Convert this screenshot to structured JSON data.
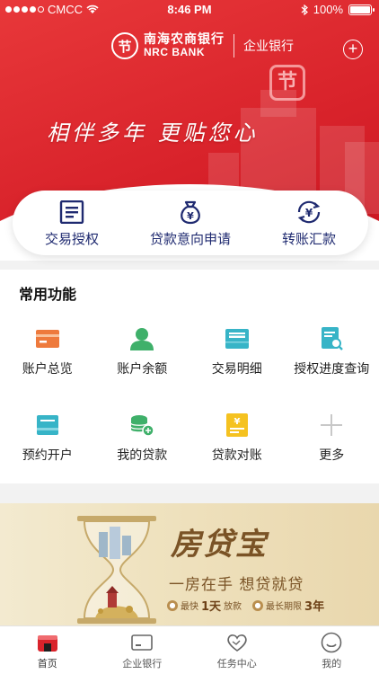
{
  "status_bar": {
    "carrier": "CMCC",
    "time": "8:46 PM",
    "battery": "100%"
  },
  "header": {
    "bank_name_cn": "南海农商银行",
    "bank_name_en": "NRC BANK",
    "corporate": "企业银行",
    "logo_glyph": "节",
    "slogan": "相伴多年 更贴您心",
    "add_icon": "plus-circle-icon"
  },
  "quick_actions": [
    {
      "label": "交易授权",
      "icon": "document-list-icon"
    },
    {
      "label": "贷款意向申请",
      "icon": "money-bag-icon"
    },
    {
      "label": "转账汇款",
      "icon": "transfer-cycle-icon"
    }
  ],
  "common_functions": {
    "title": "常用功能",
    "items": [
      {
        "label": "账户总览",
        "icon": "card-icon"
      },
      {
        "label": "账户余额",
        "icon": "user-icon"
      },
      {
        "label": "交易明细",
        "icon": "receipt-icon"
      },
      {
        "label": "授权进度查询",
        "icon": "document-search-icon"
      },
      {
        "label": "预约开户",
        "icon": "open-account-icon"
      },
      {
        "label": "我的贷款",
        "icon": "coins-icon"
      },
      {
        "label": "贷款对账",
        "icon": "bill-icon"
      },
      {
        "label": "更多",
        "icon": "plus-icon"
      }
    ]
  },
  "ad": {
    "title": "房贷宝",
    "subtitle": "一房在手 想贷就贷",
    "tag1_prefix": "最快",
    "tag1_value": "1天",
    "tag1_suffix": "放款",
    "tag2_prefix": "最长期限",
    "tag2_value": "3年"
  },
  "tab_bar": [
    {
      "label": "首页",
      "icon": "home-icon",
      "active": true
    },
    {
      "label": "企业银行",
      "icon": "wallet-card-icon",
      "active": false
    },
    {
      "label": "任务中心",
      "icon": "heart-icon",
      "active": false
    },
    {
      "label": "我的",
      "icon": "profile-smile-icon",
      "active": false
    }
  ],
  "colors": {
    "brand_red": "#d9232b",
    "navy": "#1f2a70",
    "gold": "#7a5326"
  }
}
